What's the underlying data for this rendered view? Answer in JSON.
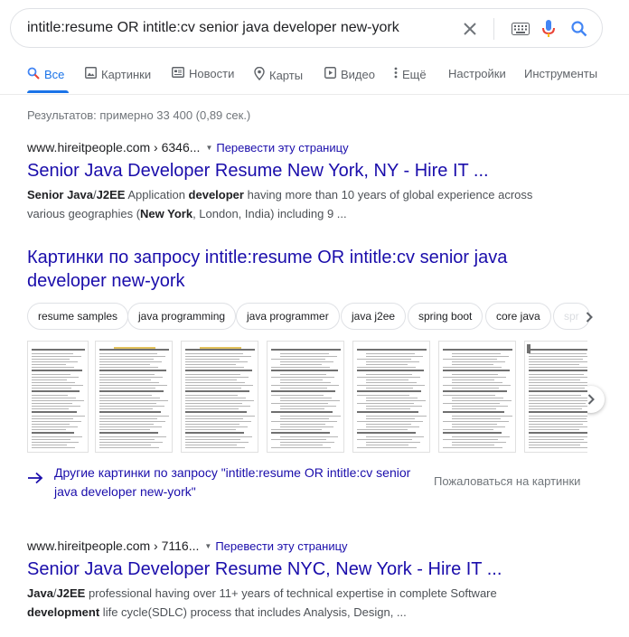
{
  "search": {
    "query": "intitle:resume OR intitle:cv senior java developer new-york",
    "clear_icon": "close-icon",
    "keyboard_icon": "keyboard-icon",
    "mic_icon": "microphone-icon",
    "search_icon": "search-icon"
  },
  "tabs": [
    {
      "label": "Все",
      "icon": "search-icon",
      "active": true
    },
    {
      "label": "Картинки",
      "icon": "image-icon"
    },
    {
      "label": "Новости",
      "icon": "news-icon"
    },
    {
      "label": "Карты",
      "icon": "map-pin-icon"
    },
    {
      "label": "Видео",
      "icon": "video-icon"
    },
    {
      "label": "Ещё",
      "icon": "more-vert-icon"
    },
    {
      "label": "Настройки"
    },
    {
      "label": "Инструменты"
    }
  ],
  "stats": "Результатов: примерно 33 400 (0,89 сек.)",
  "results": [
    {
      "url": "www.hireitpeople.com › 6346...",
      "translate": "Перевести эту страницу",
      "title": "Senior Java Developer Resume New York, NY - Hire IT ...",
      "snippet_html": "<b>Senior Java</b>/<b>J2EE</b> Application <b>developer</b> having more than 10 years of global experience across various geographies (<b>New York</b>, London, India) including 9 ..."
    },
    {
      "url": "www.hireitpeople.com › 7116...",
      "translate": "Перевести эту страницу",
      "title": "Senior Java Developer Resume NYC, New York - Hire IT ...",
      "snippet_html": "<b>Java</b>/<b>J2EE</b> professional having over 11+ years of technical expertise in complete Software <b>development</b> life cycle(SDLC) process that includes Analysis, Design, ..."
    }
  ],
  "images": {
    "heading": "Картинки по запросу intitle:resume OR intitle:cv senior java developer new-york",
    "chips": [
      "resume samples",
      "java programming",
      "java programmer",
      "java j2ee",
      "spring boot",
      "core java",
      "spr"
    ],
    "more_text": "Другие картинки по запросу \"intitle:resume OR intitle:cv senior java developer new-york\"",
    "report": "Пожаловаться на картинки"
  },
  "colors": {
    "link": "#1a0dab",
    "accent": "#1a73e8",
    "muted": "#70757a"
  }
}
